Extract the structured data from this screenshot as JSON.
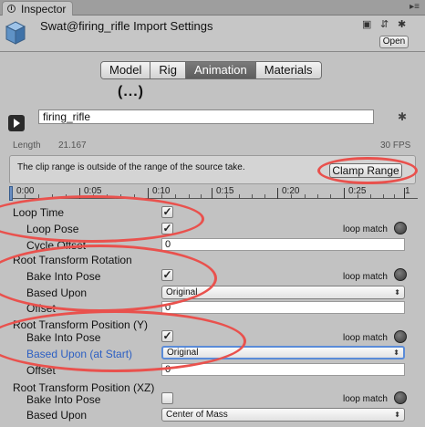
{
  "tab": {
    "title": "Inspector"
  },
  "header": {
    "title": "Swat@firing_rifle Import Settings",
    "open_label": "Open"
  },
  "segments": [
    {
      "label": "Model",
      "active": false
    },
    {
      "label": "Rig",
      "active": false
    },
    {
      "label": "Animation",
      "active": true
    },
    {
      "label": "Materials",
      "active": false
    }
  ],
  "ellipsis": "(...)",
  "clip": {
    "name": "firing_rifle",
    "length_label": "Length",
    "length_value": "21.167",
    "fps": "30 FPS"
  },
  "warning": {
    "text": "The clip range is outside of the range of the source take.",
    "clamp_label": "Clamp Range"
  },
  "timeline": {
    "ticks": [
      "0:00",
      "0:05",
      "0:10",
      "0:15",
      "0:20",
      "0:25",
      "1"
    ]
  },
  "loop_time": {
    "label": "Loop Time",
    "checked": true
  },
  "loop_pose": {
    "label": "Loop Pose",
    "checked": true,
    "match_label": "loop match"
  },
  "cycle_offset": {
    "label": "Cycle Offset",
    "value": "0"
  },
  "root_rotation": {
    "title": "Root Transform Rotation",
    "bake_label": "Bake Into Pose",
    "bake_checked": true,
    "match_label": "loop match",
    "based_label": "Based Upon",
    "based_value": "Original",
    "offset_label": "Offset",
    "offset_value": "0"
  },
  "root_pos_y": {
    "title": "Root Transform Position (Y)",
    "bake_label": "Bake Into Pose",
    "bake_checked": true,
    "match_label": "loop match",
    "based_label": "Based Upon (at Start)",
    "based_value": "Original",
    "offset_label": "Offset",
    "offset_value": "0"
  },
  "root_pos_xz": {
    "title": "Root Transform Position (XZ)",
    "bake_label": "Bake Into Pose",
    "bake_checked": false,
    "match_label": "loop match",
    "based_label": "Based Upon",
    "based_value": "Center of Mass"
  },
  "colors": {
    "annotation": "#e9514d",
    "active_segment": "#5d5d5d",
    "focus_blue": "#2c5fc3"
  }
}
